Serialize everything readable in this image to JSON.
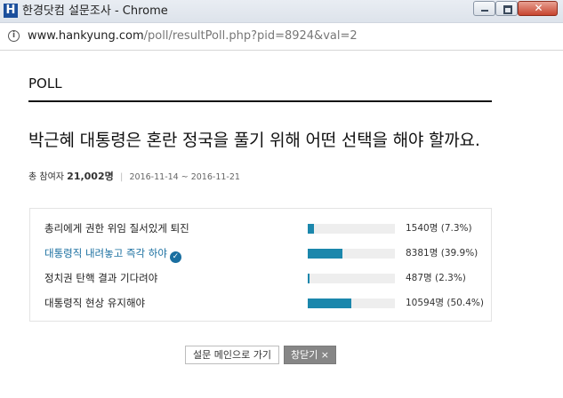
{
  "window": {
    "title": "한경닷컴 설문조사 - Chrome",
    "app_icon_letter": "H",
    "close_glyph": "✕"
  },
  "address": {
    "info_glyph": "i",
    "url_domain": "www.hankyung.com",
    "url_path": "/poll/resultPoll.php?pid=8924&val=2"
  },
  "poll": {
    "header": "POLL",
    "question": "박근혜 대통령은 혼란 정국을 풀기 위해 어떤 선택을 해야 할까요.",
    "participants_label": "총 참여자",
    "participants_count": "21,002명",
    "separator": "|",
    "period": "2016-11-14 ~ 2016-11-21",
    "selected_index": 1,
    "options": [
      {
        "label": "총리에게 권한 위임 질서있게 퇴진",
        "result": "1540명 (7.3%)",
        "percent": 7.3
      },
      {
        "label": "대통령직 내려놓고 즉각 하야",
        "result": "8381명 (39.9%)",
        "percent": 39.9
      },
      {
        "label": "정치권 탄핵 결과 기다려야",
        "result": "487명 (2.3%)",
        "percent": 2.3
      },
      {
        "label": "대통령직 현상 유지해야",
        "result": "10594명 (50.4%)",
        "percent": 50.4
      }
    ]
  },
  "buttons": {
    "main_label": "설문 메인으로 가기",
    "close_label": "창닫기 ×"
  },
  "colors": {
    "bar": "#1b87ac",
    "selected_text": "#1a6fa0"
  }
}
